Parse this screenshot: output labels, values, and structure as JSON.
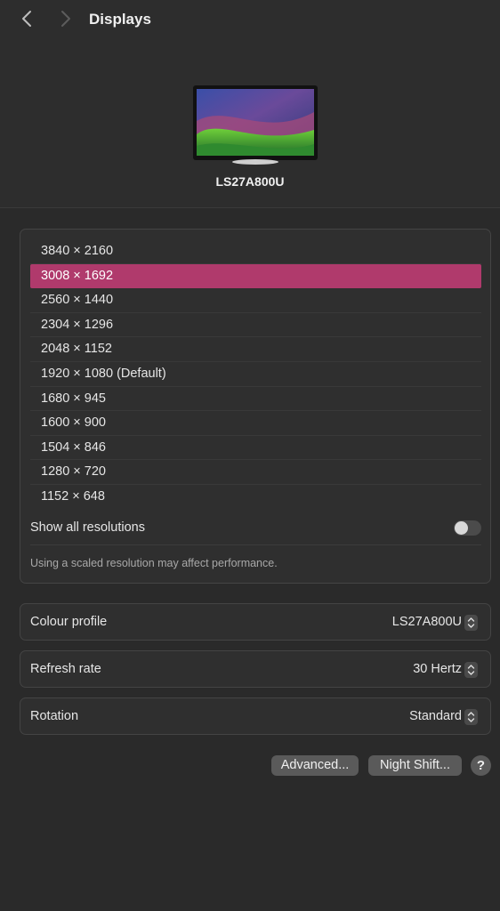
{
  "header": {
    "title": "Displays",
    "back_icon": "chevron-left-icon",
    "forward_icon": "chevron-right-icon"
  },
  "display": {
    "name": "LS27A800U"
  },
  "resolutions": {
    "items": [
      "3840 × 2160",
      "3008 × 1692",
      "2560 × 1440",
      "2304 × 1296",
      "2048 × 1152",
      "1920 × 1080 (Default)",
      "1680 × 945",
      "1600 × 900",
      "1504 × 846",
      "1280 × 720",
      "1152 × 648"
    ],
    "selected": "3008 × 1692",
    "show_all_label": "Show all resolutions",
    "show_all_enabled": false,
    "note": "Using a scaled resolution may affect performance."
  },
  "settings": {
    "colour_profile": {
      "label": "Colour profile",
      "value": "LS27A800U"
    },
    "refresh_rate": {
      "label": "Refresh rate",
      "value": "30 Hertz"
    },
    "rotation": {
      "label": "Rotation",
      "value": "Standard"
    }
  },
  "buttons": {
    "advanced": "Advanced...",
    "night_shift": "Night Shift...",
    "help": "?"
  },
  "colors": {
    "background": "#2a2a2a",
    "selection": "#b03a6c"
  }
}
